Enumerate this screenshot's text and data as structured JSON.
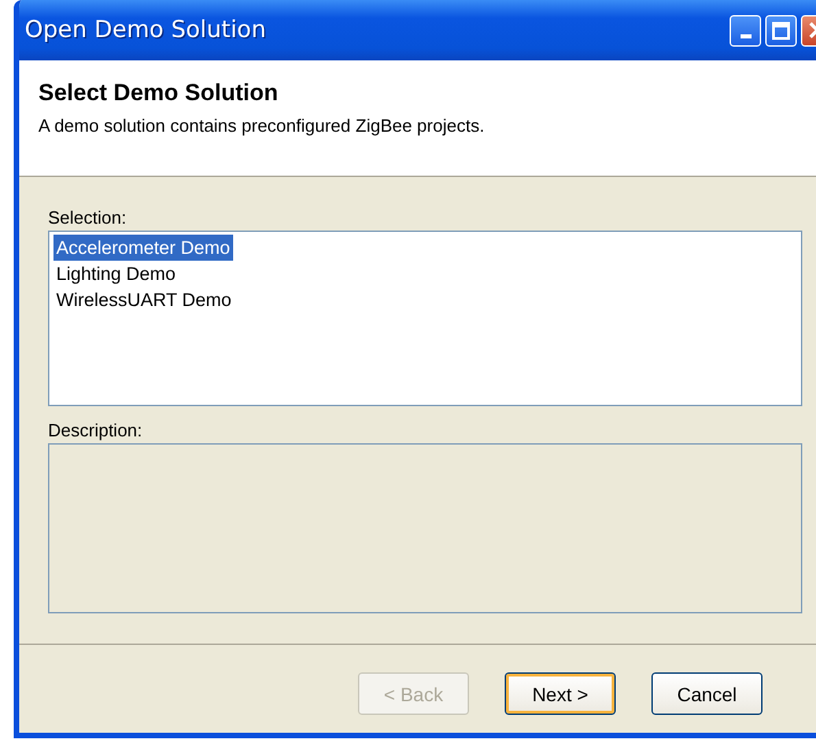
{
  "window": {
    "title": "Open Demo Solution"
  },
  "header": {
    "title": "Select Demo Solution",
    "subtitle": "A demo solution contains preconfigured ZigBee projects."
  },
  "selection": {
    "label": "Selection:",
    "items": [
      {
        "label": "Accelerometer Demo",
        "selected": true
      },
      {
        "label": "Lighting Demo",
        "selected": false
      },
      {
        "label": "WirelessUART Demo",
        "selected": false
      }
    ]
  },
  "description": {
    "label": "Description:"
  },
  "buttons": [
    {
      "label": "< Back",
      "disabled": true,
      "default": false
    },
    {
      "label": "Next >",
      "disabled": false,
      "default": true
    },
    {
      "label": "Cancel",
      "disabled": false,
      "default": false
    }
  ]
}
